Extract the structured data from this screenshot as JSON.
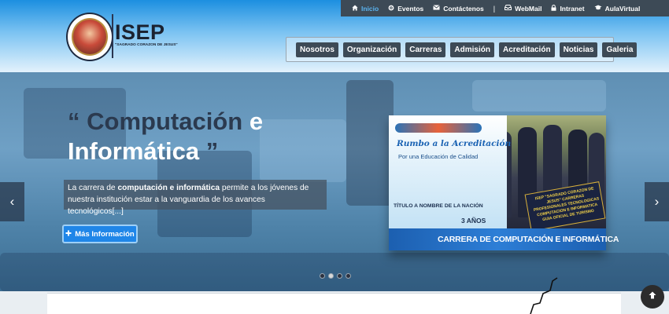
{
  "topbar": {
    "items": [
      {
        "label": "Inicio",
        "icon": "home-icon"
      },
      {
        "label": "Eventos",
        "icon": "cog-icon"
      },
      {
        "label": "Contáctenos",
        "icon": "envelope-icon"
      },
      {
        "label": "|",
        "icon": ""
      },
      {
        "label": "WebMail",
        "icon": "inbox-icon"
      },
      {
        "label": "Intranet",
        "icon": "lock-icon"
      },
      {
        "label": "AulaVirtual",
        "icon": "graduation-cap-icon"
      }
    ],
    "active_color": "#5bb4f0"
  },
  "brand": {
    "name": "ISEP",
    "subtitle": "\"SAGRADO CORAZON DE JESUS\""
  },
  "nav": {
    "items": [
      "Nosotros",
      "Organización",
      "Carreras",
      "Admisión",
      "Acreditación",
      "Noticias",
      "Galeria"
    ]
  },
  "hero": {
    "title_open_quote": "“",
    "title_word1": "Computación",
    "title_word2": "e",
    "title_word3": "Informática",
    "title_close_quote": "”",
    "desc_prefix": "La carrera de",
    "desc_bold": "computación e informática",
    "desc_suffix": "permite a los jóvenes de nuestra institución estar a la vanguardia de los avances tecnológicos[...]",
    "cta_label": "Más Información",
    "cta_icon": "plus-icon"
  },
  "promo": {
    "rumbo": "Rumbo a la Acreditación",
    "calidad": "Por una Educación de Calidad",
    "banner": "ISEP \"SAGRADO CORAZON DE JESUS\" CARRERAS PROFESIONALES TECNOLOGICAS COMPUTACION E INFORMATICA GUIA OFICIAL DE TURISMO",
    "title_line": "TÍTULO A NOMBRE DE LA NACIÓN",
    "years": "3 AÑOS",
    "career": "CARRERA DE COMPUTACIÓN E INFORMÁTICA"
  },
  "slider": {
    "prev": "‹",
    "next": "›",
    "dots_count": 4,
    "active_dot": 1
  },
  "colors": {
    "topbar_bg": "#3d4a56",
    "nav_item_bg": "#3d4a56",
    "cta_bg": "#1f86e8",
    "hero_title_dark": "#2b3a4f"
  }
}
